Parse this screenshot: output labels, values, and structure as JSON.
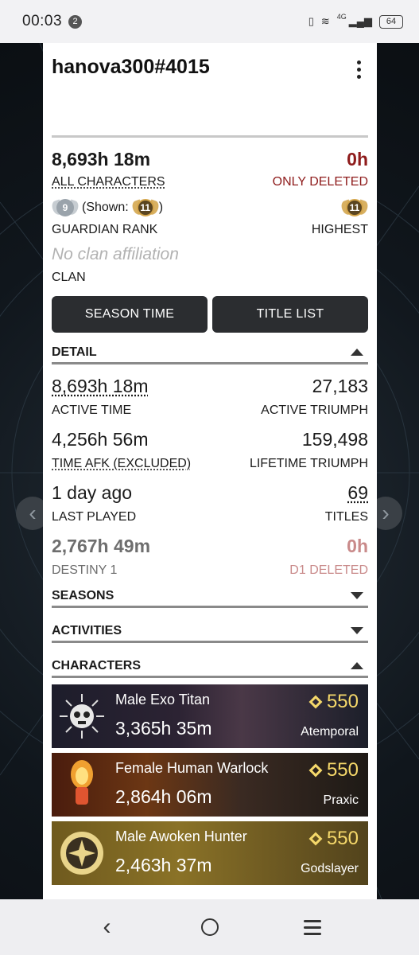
{
  "status_bar": {
    "time": "00:03",
    "notif_count": "2",
    "network": "4G",
    "battery": "64"
  },
  "profile": {
    "username": "hanova300#4015"
  },
  "playtime": {
    "total": "8,693h 18m",
    "total_label": "ALL CHARACTERS",
    "deleted": "0h",
    "deleted_label": "ONLY DELETED"
  },
  "rank": {
    "current": "9",
    "shown_prefix": "(Shown:",
    "shown": "11",
    "shown_suffix": ")",
    "label": "GUARDIAN RANK",
    "highest": "11",
    "highest_label": "HIGHEST"
  },
  "clan": {
    "value": "No clan affiliation",
    "label": "CLAN"
  },
  "buttons": {
    "season_time": "SEASON TIME",
    "title_list": "TITLE LIST"
  },
  "sections": {
    "detail": "DETAIL",
    "seasons": "SEASONS",
    "activities": "ACTIVITIES",
    "characters": "CHARACTERS"
  },
  "detail": {
    "active_time": "8,693h 18m",
    "active_time_label": "ACTIVE TIME",
    "active_triumph": "27,183",
    "active_triumph_label": "ACTIVE TRIUMPH",
    "afk_time": "4,256h 56m",
    "afk_label": "TIME AFK (EXCLUDED)",
    "lifetime_triumph": "159,498",
    "lifetime_triumph_label": "LIFETIME TRIUMPH",
    "last_played": "1 day ago",
    "last_played_label": "LAST PLAYED",
    "titles": "69",
    "titles_label": "TITLES",
    "destiny1": "2,767h 49m",
    "destiny1_label": "DESTINY 1",
    "d1_deleted": "0h",
    "d1_deleted_label": "D1 DELETED"
  },
  "characters": [
    {
      "name": "Male Exo Titan",
      "time": "3,365h 35m",
      "power": "550",
      "title": "Atemporal"
    },
    {
      "name": "Female Human Warlock",
      "time": "2,864h 06m",
      "power": "550",
      "title": "Praxic"
    },
    {
      "name": "Male Awoken Hunter",
      "time": "2,463h 37m",
      "power": "550",
      "title": "Godslayer"
    }
  ],
  "colors": {
    "deleted_red": "#8e1b1b",
    "power_gold": "#f5d86a",
    "button_dark": "#2b2d30"
  }
}
